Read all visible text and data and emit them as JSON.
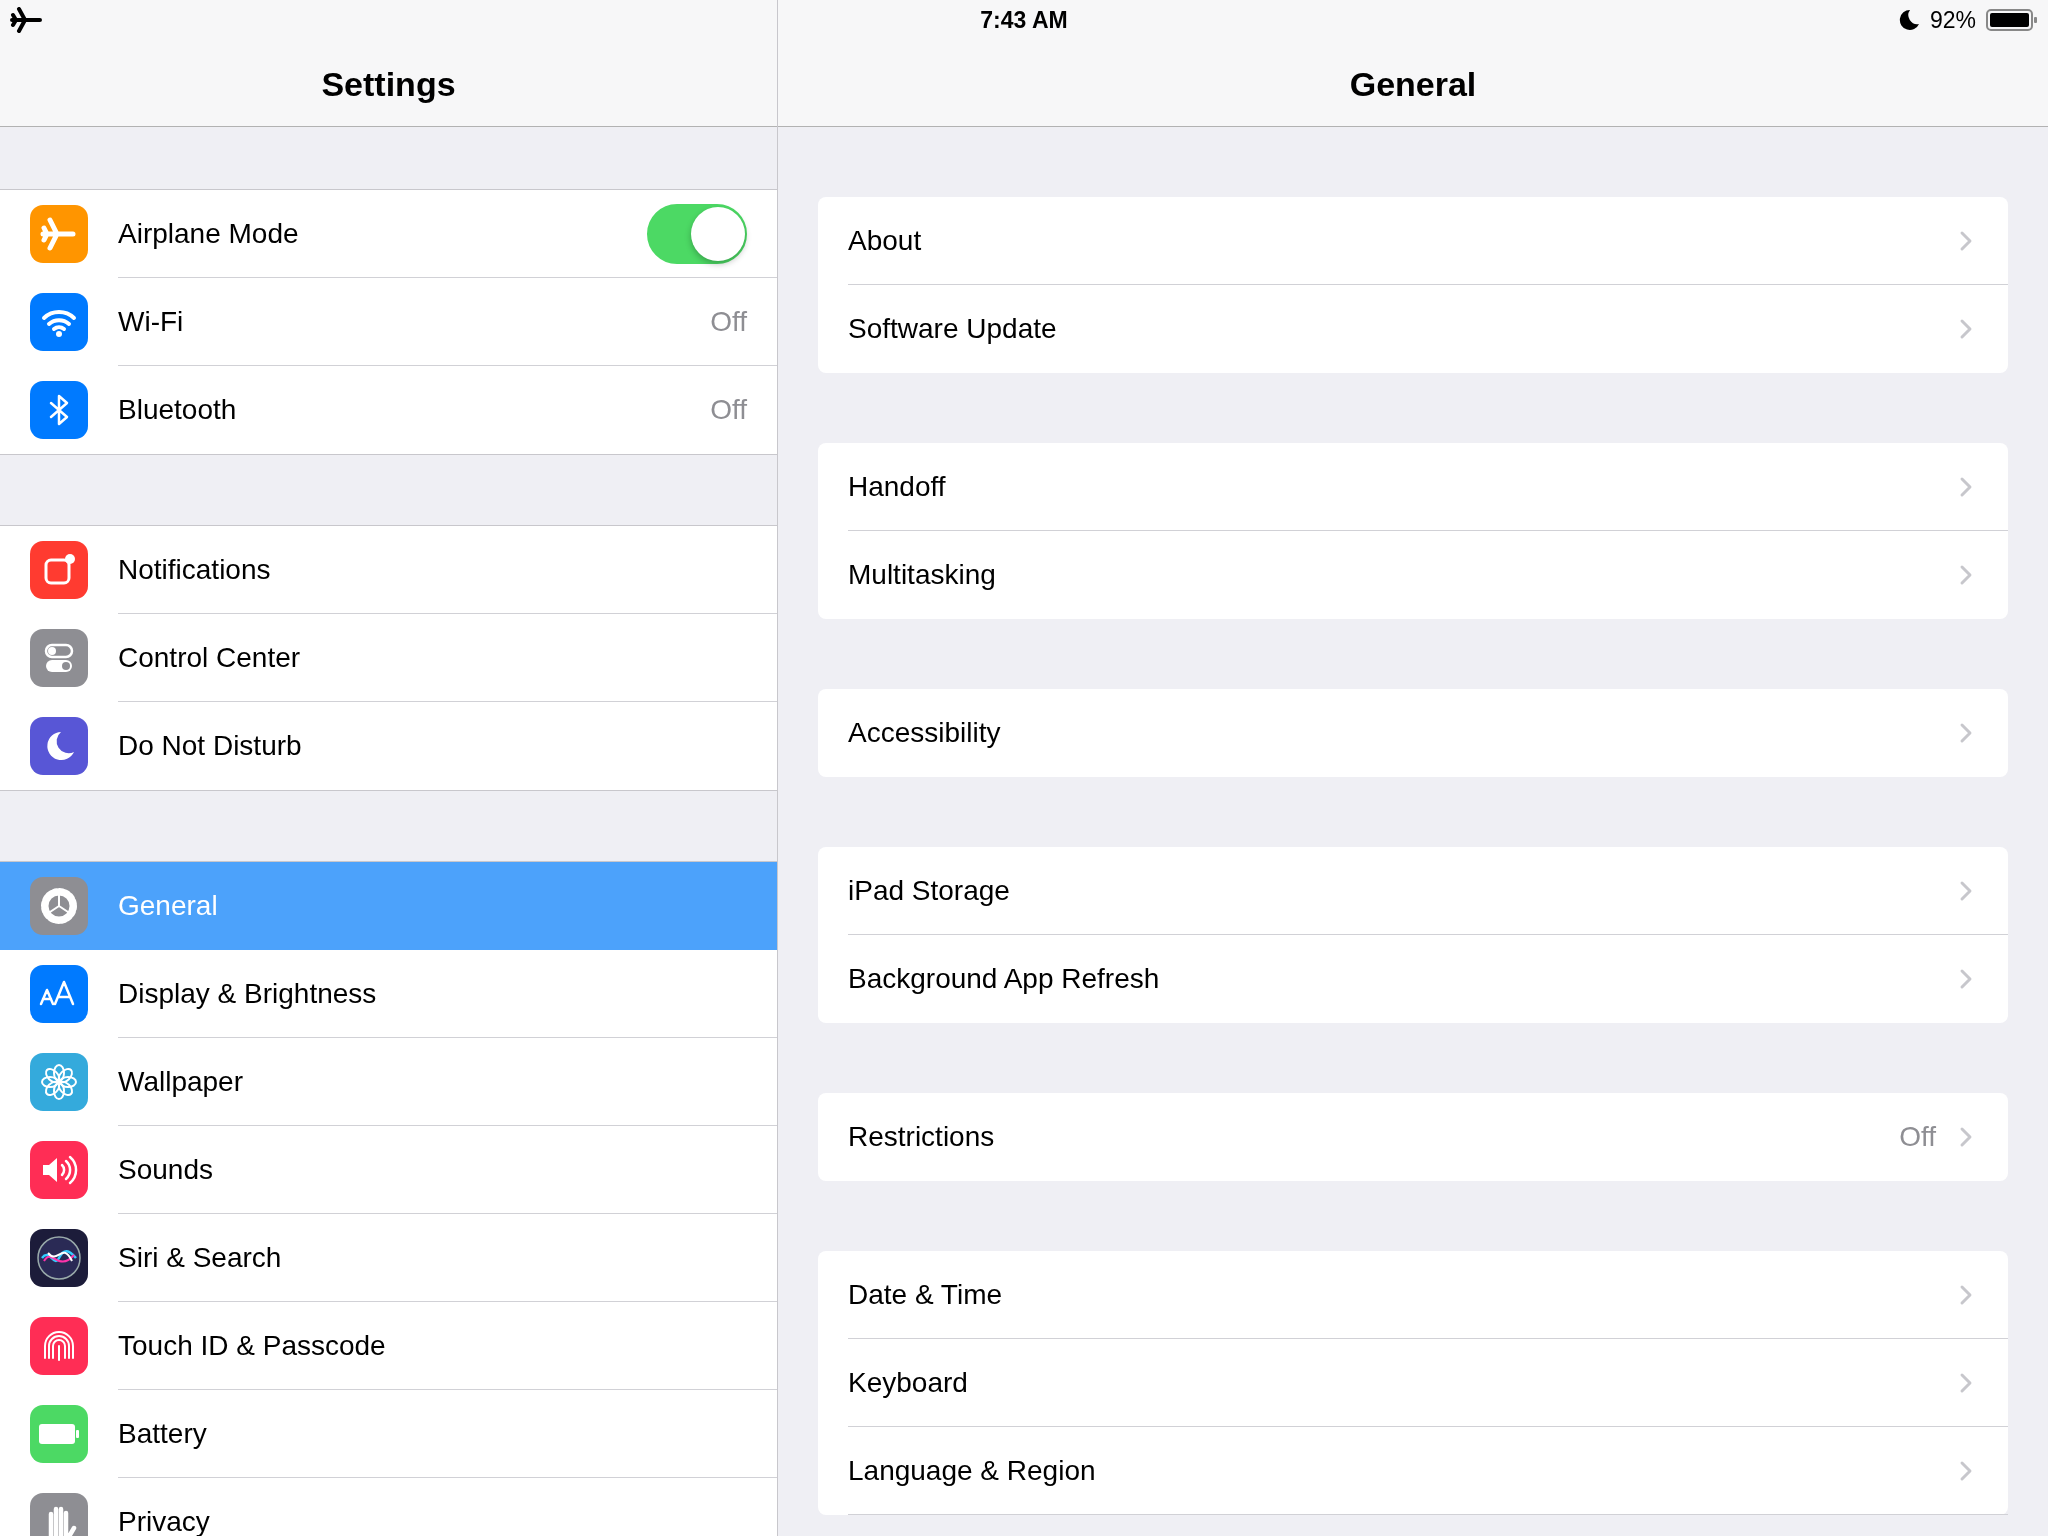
{
  "status_bar": {
    "time": "7:43 AM",
    "battery": "92%"
  },
  "sidebar": {
    "title": "Settings",
    "groups": [
      {
        "items": [
          {
            "label": "Airplane Mode",
            "color": "#ff9500",
            "kind": "toggle",
            "on": true,
            "selected": false
          },
          {
            "label": "Wi-Fi",
            "color": "#007aff",
            "kind": "value",
            "value": "Off",
            "selected": false
          },
          {
            "label": "Bluetooth",
            "color": "#007aff",
            "kind": "value",
            "value": "Off",
            "selected": false
          }
        ]
      },
      {
        "items": [
          {
            "label": "Notifications",
            "color": "#ff3b30",
            "kind": "link",
            "selected": false
          },
          {
            "label": "Control Center",
            "color": "#8e8e93",
            "kind": "link",
            "selected": false
          },
          {
            "label": "Do Not Disturb",
            "color": "#5856d6",
            "kind": "link",
            "selected": false
          }
        ]
      },
      {
        "items": [
          {
            "label": "General",
            "color": "#8e8e93",
            "kind": "link",
            "selected": true
          },
          {
            "label": "Display & Brightness",
            "color": "#007aff",
            "kind": "link",
            "selected": false
          },
          {
            "label": "Wallpaper",
            "color": "#34aadc",
            "kind": "link",
            "selected": false
          },
          {
            "label": "Sounds",
            "color": "#ff2d55",
            "kind": "link",
            "selected": false
          },
          {
            "label": "Siri & Search",
            "color": "#1c1c3a",
            "kind": "link",
            "selected": false
          },
          {
            "label": "Touch ID & Passcode",
            "color": "#ff2d55",
            "kind": "link",
            "selected": false
          },
          {
            "label": "Battery",
            "color": "#4cd964",
            "kind": "link",
            "selected": false
          },
          {
            "label": "Privacy",
            "color": "#8e8e93",
            "kind": "link",
            "selected": false
          }
        ]
      }
    ]
  },
  "detail": {
    "title": "General",
    "groups": [
      {
        "rows": [
          {
            "label": "About"
          },
          {
            "label": "Software Update"
          }
        ]
      },
      {
        "rows": [
          {
            "label": "Handoff"
          },
          {
            "label": "Multitasking"
          }
        ]
      },
      {
        "rows": [
          {
            "label": "Accessibility"
          }
        ]
      },
      {
        "rows": [
          {
            "label": "iPad Storage"
          },
          {
            "label": "Background App Refresh"
          }
        ]
      },
      {
        "rows": [
          {
            "label": "Restrictions",
            "value": "Off"
          }
        ]
      },
      {
        "rows": [
          {
            "label": "Date & Time"
          },
          {
            "label": "Keyboard"
          },
          {
            "label": "Language & Region"
          }
        ]
      }
    ]
  }
}
